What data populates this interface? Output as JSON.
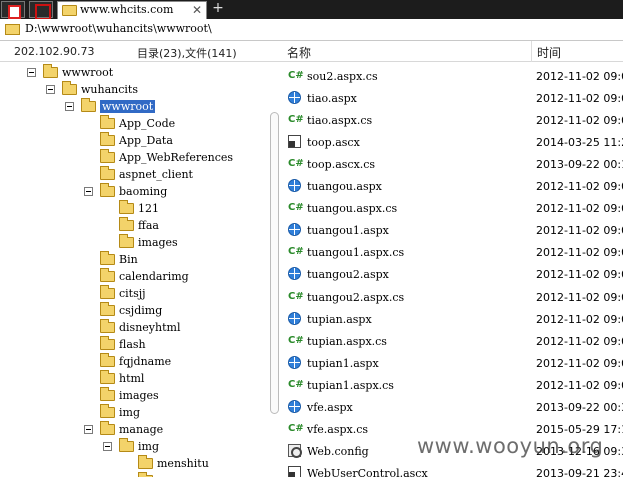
{
  "tab": {
    "title": "www.whcits.com",
    "close": "✕",
    "new": "+"
  },
  "address": {
    "path": "D:\\wwwroot\\wuhancits\\wwwroot\\"
  },
  "header": {
    "ip": "202.102.90.73",
    "counts": "目录(23),文件(141)",
    "col_name": "名称",
    "col_time": "时间"
  },
  "tree": [
    {
      "label": "wwwroot",
      "level": 0,
      "expanded": true
    },
    {
      "label": "wuhancits",
      "level": 1,
      "expanded": true
    },
    {
      "label": "wwwroot",
      "level": 2,
      "expanded": true,
      "selected": true
    },
    {
      "label": "App_Code",
      "level": 3
    },
    {
      "label": "App_Data",
      "level": 3
    },
    {
      "label": "App_WebReferences",
      "level": 3
    },
    {
      "label": "aspnet_client",
      "level": 3
    },
    {
      "label": "baoming",
      "level": 3,
      "expanded": true
    },
    {
      "label": "121",
      "level": 4
    },
    {
      "label": "ffaa",
      "level": 4
    },
    {
      "label": "images",
      "level": 4
    },
    {
      "label": "Bin",
      "level": 3
    },
    {
      "label": "calendarimg",
      "level": 3
    },
    {
      "label": "citsjj",
      "level": 3
    },
    {
      "label": "csjdimg",
      "level": 3
    },
    {
      "label": "disneyhtml",
      "level": 3
    },
    {
      "label": "flash",
      "level": 3
    },
    {
      "label": "fqjdname",
      "level": 3
    },
    {
      "label": "html",
      "level": 3
    },
    {
      "label": "images",
      "level": 3
    },
    {
      "label": "img",
      "level": 3
    },
    {
      "label": "manage",
      "level": 3,
      "expanded": true
    },
    {
      "label": "img",
      "level": 4,
      "expanded": true
    },
    {
      "label": "menshitu",
      "level": 5
    },
    {
      "label": "",
      "level": 5
    }
  ],
  "files": [
    {
      "name": "sou2.aspx.cs",
      "icon": "cs",
      "time": "2012-11-02 09:0"
    },
    {
      "name": "tiao.aspx",
      "icon": "globe",
      "time": "2012-11-02 09:0"
    },
    {
      "name": "tiao.aspx.cs",
      "icon": "cs",
      "time": "2012-11-02 09:0"
    },
    {
      "name": "toop.ascx",
      "icon": "ctrl",
      "time": "2014-03-25 11:2"
    },
    {
      "name": "toop.ascx.cs",
      "icon": "cs",
      "time": "2013-09-22 00:1"
    },
    {
      "name": "tuangou.aspx",
      "icon": "globe",
      "time": "2012-11-02 09:0"
    },
    {
      "name": "tuangou.aspx.cs",
      "icon": "cs",
      "time": "2012-11-02 09:0"
    },
    {
      "name": "tuangou1.aspx",
      "icon": "globe",
      "time": "2012-11-02 09:0"
    },
    {
      "name": "tuangou1.aspx.cs",
      "icon": "cs",
      "time": "2012-11-02 09:0"
    },
    {
      "name": "tuangou2.aspx",
      "icon": "globe",
      "time": "2012-11-02 09:0"
    },
    {
      "name": "tuangou2.aspx.cs",
      "icon": "cs",
      "time": "2012-11-02 09:0"
    },
    {
      "name": "tupian.aspx",
      "icon": "globe",
      "time": "2012-11-02 09:0"
    },
    {
      "name": "tupian.aspx.cs",
      "icon": "cs",
      "time": "2012-11-02 09:0"
    },
    {
      "name": "tupian1.aspx",
      "icon": "globe",
      "time": "2012-11-02 09:0"
    },
    {
      "name": "tupian1.aspx.cs",
      "icon": "cs",
      "time": "2012-11-02 09:0"
    },
    {
      "name": "vfe.aspx",
      "icon": "globe",
      "time": "2013-09-22 00:3"
    },
    {
      "name": "vfe.aspx.cs",
      "icon": "cs",
      "time": "2015-05-29 17:1"
    },
    {
      "name": "Web.config",
      "icon": "cfg",
      "time": "2013-12-16 09:3"
    },
    {
      "name": "WebUserControl.ascx",
      "icon": "ctrl",
      "time": "2013-09-21 23:4"
    }
  ],
  "watermark": "www.wooyun.org"
}
